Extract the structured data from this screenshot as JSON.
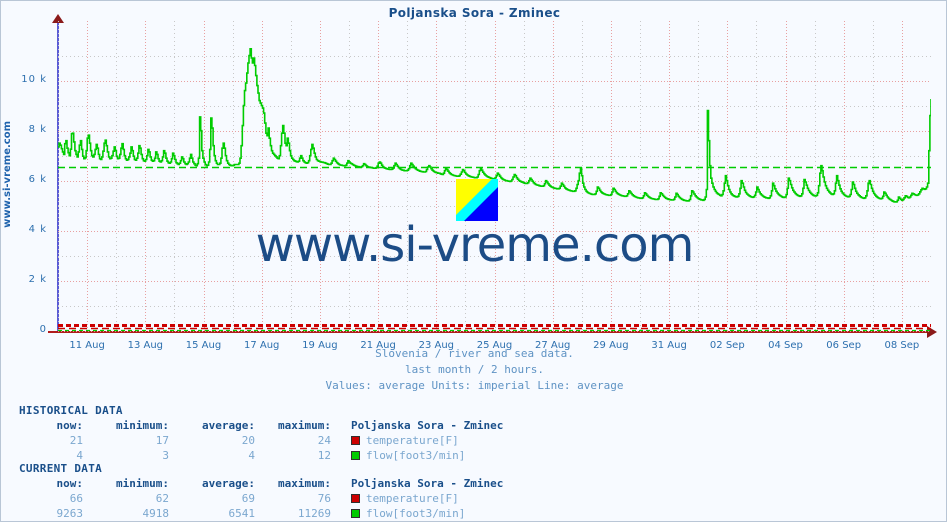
{
  "page": {
    "title": "Poljanska Sora - Zminec",
    "side_label": "www.si-vreme.com",
    "watermark": "www.si-vreme.com"
  },
  "subtitle": {
    "line1": "Slovenia / river and sea data.",
    "line2": "last month / 2 hours.",
    "line3": "Values: average  Units: imperial  Line: average"
  },
  "colors": {
    "title": "#1a4f8a",
    "axis_label": "#2c6fae",
    "temperature": "#cc0000",
    "flow": "#00cc00",
    "grid_major": "#e8a0a0",
    "grid_minor": "#c8c8c8",
    "watermark": "#1c4c86",
    "x_axis": "#b01c1c",
    "y_axis": "#5b5bd6"
  },
  "historical": {
    "heading": "HISTORICAL DATA",
    "columns": [
      "now:",
      "minimum:",
      "average:",
      "maximum:",
      "Poljanska Sora - Zminec"
    ],
    "rows": [
      {
        "now": "21",
        "minimum": "17",
        "average": "20",
        "maximum": "24",
        "name": "temperature[F]",
        "color": "#cc0000"
      },
      {
        "now": "4",
        "minimum": "3",
        "average": "4",
        "maximum": "12",
        "name": "flow[foot3/min]",
        "color": "#00cc00"
      }
    ]
  },
  "current": {
    "heading": "CURRENT DATA",
    "columns": [
      "now:",
      "minimum:",
      "average:",
      "maximum:",
      "Poljanska Sora - Zminec"
    ],
    "rows": [
      {
        "now": "66",
        "minimum": "62",
        "average": "69",
        "maximum": "76",
        "name": "temperature[F]",
        "color": "#cc0000"
      },
      {
        "now": "9263",
        "minimum": "4918",
        "average": "6541",
        "maximum": "11269",
        "name": "flow[foot3/min]",
        "color": "#00cc00"
      }
    ]
  },
  "chart_data": {
    "type": "line",
    "title": "Poljanska Sora - Zminec",
    "xlabel": "",
    "ylabel": "",
    "ylim": [
      0,
      11500
    ],
    "grid": true,
    "legend_position": "below-table",
    "y_ticks": [
      {
        "label": "0",
        "value": 0
      },
      {
        "label": "2 k",
        "value": 2000
      },
      {
        "label": "4 k",
        "value": 4000
      },
      {
        "label": "6 k",
        "value": 6000
      },
      {
        "label": "8 k",
        "value": 8000
      },
      {
        "label": "10 k",
        "value": 10000
      }
    ],
    "x_ticks": [
      "11 Aug",
      "13 Aug",
      "15 Aug",
      "17 Aug",
      "19 Aug",
      "21 Aug",
      "23 Aug",
      "25 Aug",
      "27 Aug",
      "29 Aug",
      "31 Aug",
      "02 Sep",
      "04 Sep",
      "06 Sep",
      "08 Sep"
    ],
    "x_start": "10 Aug",
    "x_end": "09 Sep",
    "average_lines": [
      {
        "series": "flow",
        "value": 6541,
        "style": "dashed",
        "color": "#00cc00"
      },
      {
        "series": "temperature",
        "value": 69,
        "style": "dashed",
        "color": "#cc0000"
      }
    ],
    "series": [
      {
        "name": "flow[foot3/min]",
        "color": "#00cc00",
        "units": "foot3/min",
        "now": 9263,
        "min": 4918,
        "avg": 6541,
        "max": 11269,
        "values": [
          7350,
          7500,
          7420,
          7280,
          7150,
          7050,
          7480,
          7600,
          7300,
          7120,
          7000,
          7260,
          7880,
          7900,
          7550,
          7200,
          7050,
          6950,
          7150,
          7420,
          7600,
          7250,
          6980,
          6880,
          6920,
          7200,
          7700,
          7820,
          7500,
          7200,
          7000,
          6950,
          7050,
          7250,
          7450,
          7300,
          7050,
          6880,
          6850,
          6950,
          7180,
          7500,
          7620,
          7400,
          7150,
          6950,
          6880,
          6900,
          7000,
          7180,
          7350,
          7200,
          6980,
          6880,
          6900,
          7050,
          7300,
          7480,
          7250,
          7000,
          6880,
          6820,
          6850,
          6950,
          7100,
          7350,
          7200,
          6980,
          6850,
          6820,
          6900,
          7100,
          7400,
          7300,
          7050,
          6880,
          6800,
          6780,
          6850,
          7000,
          7250,
          7150,
          6950,
          6820,
          6780,
          6800,
          6900,
          7150,
          7050,
          6880,
          6780,
          6750,
          6800,
          6950,
          7200,
          7100,
          6900,
          6780,
          6720,
          6700,
          6750,
          6880,
          7100,
          7000,
          6850,
          6720,
          6680,
          6650,
          6700,
          6800,
          6950,
          6880,
          6750,
          6680,
          6650,
          6680,
          6750,
          6900,
          7050,
          6900,
          6750,
          6680,
          6620,
          6600,
          6680,
          6900,
          8550,
          8000,
          7200,
          6900,
          6750,
          6650,
          6600,
          6620,
          6750,
          7250,
          8500,
          8100,
          7400,
          7000,
          6800,
          6700,
          6650,
          6650,
          6700,
          6900,
          7300,
          7500,
          7300,
          7000,
          6800,
          6700,
          6650,
          6620,
          6600,
          6600,
          6620,
          6650,
          6650,
          6650,
          6650,
          6700,
          6900,
          7400,
          8200,
          9000,
          9600,
          9900,
          10300,
          10700,
          11000,
          11269,
          10900,
          10700,
          10900,
          10600,
          10200,
          9800,
          9500,
          9200,
          9100,
          9000,
          8900,
          8700,
          8300,
          7900,
          7800,
          8100,
          7700,
          7400,
          7200,
          7100,
          7050,
          7000,
          6950,
          6900,
          6880,
          7000,
          7400,
          7900,
          8200,
          7900,
          7500,
          7400,
          7700,
          7500,
          7200,
          7000,
          6900,
          6850,
          6800,
          6780,
          6760,
          6750,
          6780,
          6900,
          7000,
          6900,
          6800,
          6750,
          6720,
          6700,
          6720,
          6800,
          7000,
          7250,
          7450,
          7300,
          7100,
          6950,
          6850,
          6800,
          6780,
          6760,
          6750,
          6740,
          6730,
          6720,
          6700,
          6680,
          6660,
          6650,
          6650,
          6700,
          6800,
          6900,
          6850,
          6780,
          6720,
          6680,
          6650,
          6630,
          6620,
          6610,
          6600,
          6600,
          6620,
          6700,
          6800,
          6750,
          6700,
          6680,
          6650,
          6620,
          6600,
          6580,
          6570,
          6560,
          6550,
          6550,
          6560,
          6600,
          6680,
          6650,
          6600,
          6570,
          6550,
          6540,
          6530,
          6520,
          6510,
          6500,
          6500,
          6520,
          6580,
          6700,
          6750,
          6700,
          6620,
          6560,
          6520,
          6500,
          6480,
          6470,
          6460,
          6450,
          6450,
          6460,
          6500,
          6600,
          6700,
          6650,
          6580,
          6520,
          6480,
          6450,
          6430,
          6420,
          6400,
          6400,
          6400,
          6420,
          6480,
          6600,
          6700,
          6650,
          6580,
          6520,
          6480,
          6450,
          6420,
          6400,
          6380,
          6370,
          6360,
          6350,
          6350,
          6370,
          6450,
          6550,
          6600,
          6550,
          6480,
          6420,
          6380,
          6350,
          6330,
          6320,
          6300,
          6300,
          6280,
          6260,
          6250,
          6300,
          6400,
          6500,
          6450,
          6380,
          6320,
          6280,
          6250,
          6230,
          6210,
          6200,
          6190,
          6180,
          6180,
          6200,
          6260,
          6350,
          6450,
          6400,
          6330,
          6270,
          6230,
          6200,
          6180,
          6160,
          6150,
          6140,
          6130,
          6120,
          6120,
          6150,
          6250,
          6400,
          6500,
          6420,
          6340,
          6280,
          6230,
          6190,
          6160,
          6140,
          6120,
          6100,
          6090,
          6080,
          6080,
          6120,
          6200,
          6300,
          6250,
          6180,
          6120,
          6080,
          6050,
          6030,
          6010,
          6000,
          5990,
          5980,
          5970,
          5990,
          6050,
          6150,
          6250,
          6200,
          6120,
          6060,
          6010,
          5980,
          5960,
          5940,
          5920,
          5900,
          5890,
          5890,
          5920,
          6000,
          6100,
          6050,
          5980,
          5920,
          5880,
          5850,
          5830,
          5820,
          5800,
          5790,
          5780,
          5780,
          5800,
          5880,
          6000,
          5950,
          5880,
          5820,
          5780,
          5750,
          5730,
          5710,
          5700,
          5690,
          5680,
          5680,
          5700,
          5780,
          5900,
          5850,
          5780,
          5720,
          5680,
          5650,
          5630,
          5620,
          5600,
          5590,
          5580,
          5580,
          5600,
          5700,
          5850,
          6000,
          6300,
          6500,
          6200,
          5900,
          5750,
          5650,
          5580,
          5540,
          5510,
          5490,
          5470,
          5460,
          5450,
          5450,
          5480,
          5580,
          5750,
          5700,
          5620,
          5560,
          5520,
          5490,
          5470,
          5450,
          5440,
          5430,
          5420,
          5420,
          5450,
          5550,
          5700,
          5650,
          5580,
          5520,
          5480,
          5450,
          5430,
          5410,
          5400,
          5390,
          5380,
          5380,
          5400,
          5480,
          5600,
          5550,
          5490,
          5440,
          5400,
          5370,
          5350,
          5330,
          5320,
          5310,
          5300,
          5300,
          5320,
          5400,
          5520,
          5480,
          5420,
          5370,
          5340,
          5310,
          5290,
          5280,
          5270,
          5260,
          5250,
          5250,
          5280,
          5380,
          5520,
          5480,
          5420,
          5370,
          5330,
          5300,
          5280,
          5260,
          5250,
          5240,
          5230,
          5230,
          5260,
          5350,
          5500,
          5450,
          5380,
          5330,
          5290,
          5260,
          5240,
          5220,
          5210,
          5200,
          5190,
          5200,
          5250,
          5400,
          5600,
          5550,
          5470,
          5400,
          5350,
          5310,
          5280,
          5260,
          5240,
          5230,
          5220,
          5250,
          5350,
          5650,
          8800,
          7600,
          6600,
          6100,
          5900,
          5750,
          5650,
          5580,
          5520,
          5480,
          5450,
          5420,
          5400,
          5450,
          5600,
          5900,
          6200,
          6000,
          5800,
          5650,
          5550,
          5480,
          5430,
          5400,
          5380,
          5360,
          5350,
          5380,
          5480,
          5700,
          6000,
          5900,
          5750,
          5620,
          5530,
          5470,
          5430,
          5400,
          5370,
          5350,
          5340,
          5360,
          5420,
          5550,
          5750,
          5650,
          5550,
          5480,
          5430,
          5390,
          5360,
          5340,
          5320,
          5310,
          5300,
          5320,
          5400,
          5600,
          5900,
          5800,
          5680,
          5580,
          5510,
          5460,
          5420,
          5390,
          5360,
          5340,
          5330,
          5350,
          5450,
          5700,
          6100,
          6000,
          5850,
          5720,
          5620,
          5550,
          5490,
          5450,
          5420,
          5400,
          5380,
          5400,
          5480,
          5700,
          6050,
          5950,
          5820,
          5700,
          5610,
          5540,
          5490,
          5450,
          5420,
          5400,
          5390,
          5420,
          5520,
          5800,
          6300,
          6600,
          6400,
          6150,
          5950,
          5800,
          5700,
          5620,
          5560,
          5510,
          5470,
          5450,
          5480,
          5600,
          5900,
          6200,
          6000,
          5820,
          5680,
          5580,
          5510,
          5460,
          5420,
          5390,
          5370,
          5360,
          5380,
          5450,
          5650,
          5950,
          5850,
          5700,
          5580,
          5500,
          5440,
          5400,
          5360,
          5330,
          5310,
          5300,
          5320,
          5400,
          5600,
          5900,
          6000,
          5850,
          5700,
          5580,
          5490,
          5430,
          5380,
          5340,
          5310,
          5290,
          5280,
          5300,
          5380,
          5550,
          5500,
          5420,
          5350,
          5300,
          5260,
          5230,
          5200,
          5180,
          5160,
          5150,
          5160,
          5220,
          5350,
          5300,
          5250,
          5220,
          5250,
          5320,
          5400,
          5380,
          5340,
          5320,
          5350,
          5420,
          5500,
          5480,
          5450,
          5430,
          5420,
          5430,
          5480,
          5560,
          5640,
          5700,
          5680,
          5660,
          5680,
          5750,
          5900,
          7200,
          8600,
          9263
        ]
      },
      {
        "name": "temperature[F]",
        "color": "#cc0000",
        "units": "F",
        "now": 66,
        "min": 62,
        "avg": 69,
        "max": 76,
        "note": "Plotted near the zero baseline because values (62-76 F) are tiny on the flow scale."
      }
    ]
  }
}
